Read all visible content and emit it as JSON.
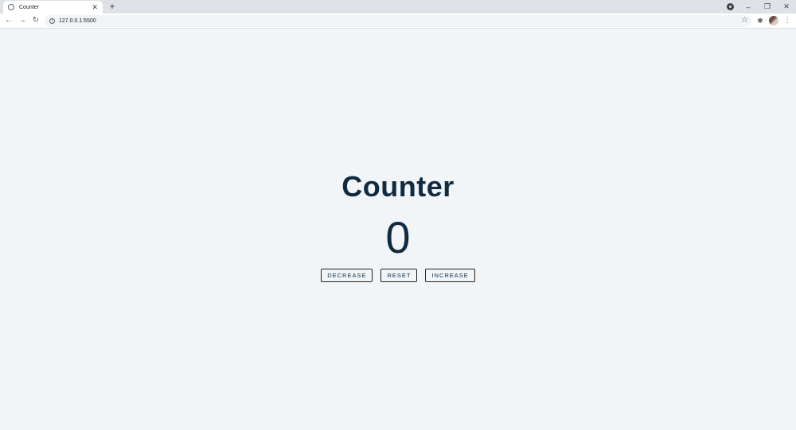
{
  "browser": {
    "tab_title": "Counter",
    "tab_close": "✕",
    "new_tab": "+",
    "url": "127.0.0.1:5500",
    "nav": {
      "back": "←",
      "forward": "→",
      "reload": "↻"
    },
    "window_controls": {
      "minimize": "–",
      "restore": "❐",
      "close": "✕"
    },
    "star": "☆",
    "extensions": "✱",
    "menu": "⋮"
  },
  "page": {
    "title": "Counter",
    "value": "0",
    "buttons": {
      "decrease": "DECREASE",
      "reset": "RESET",
      "increase": "INCREASE"
    }
  },
  "colors": {
    "background": "#f1f5f8",
    "text": "#102a42"
  }
}
